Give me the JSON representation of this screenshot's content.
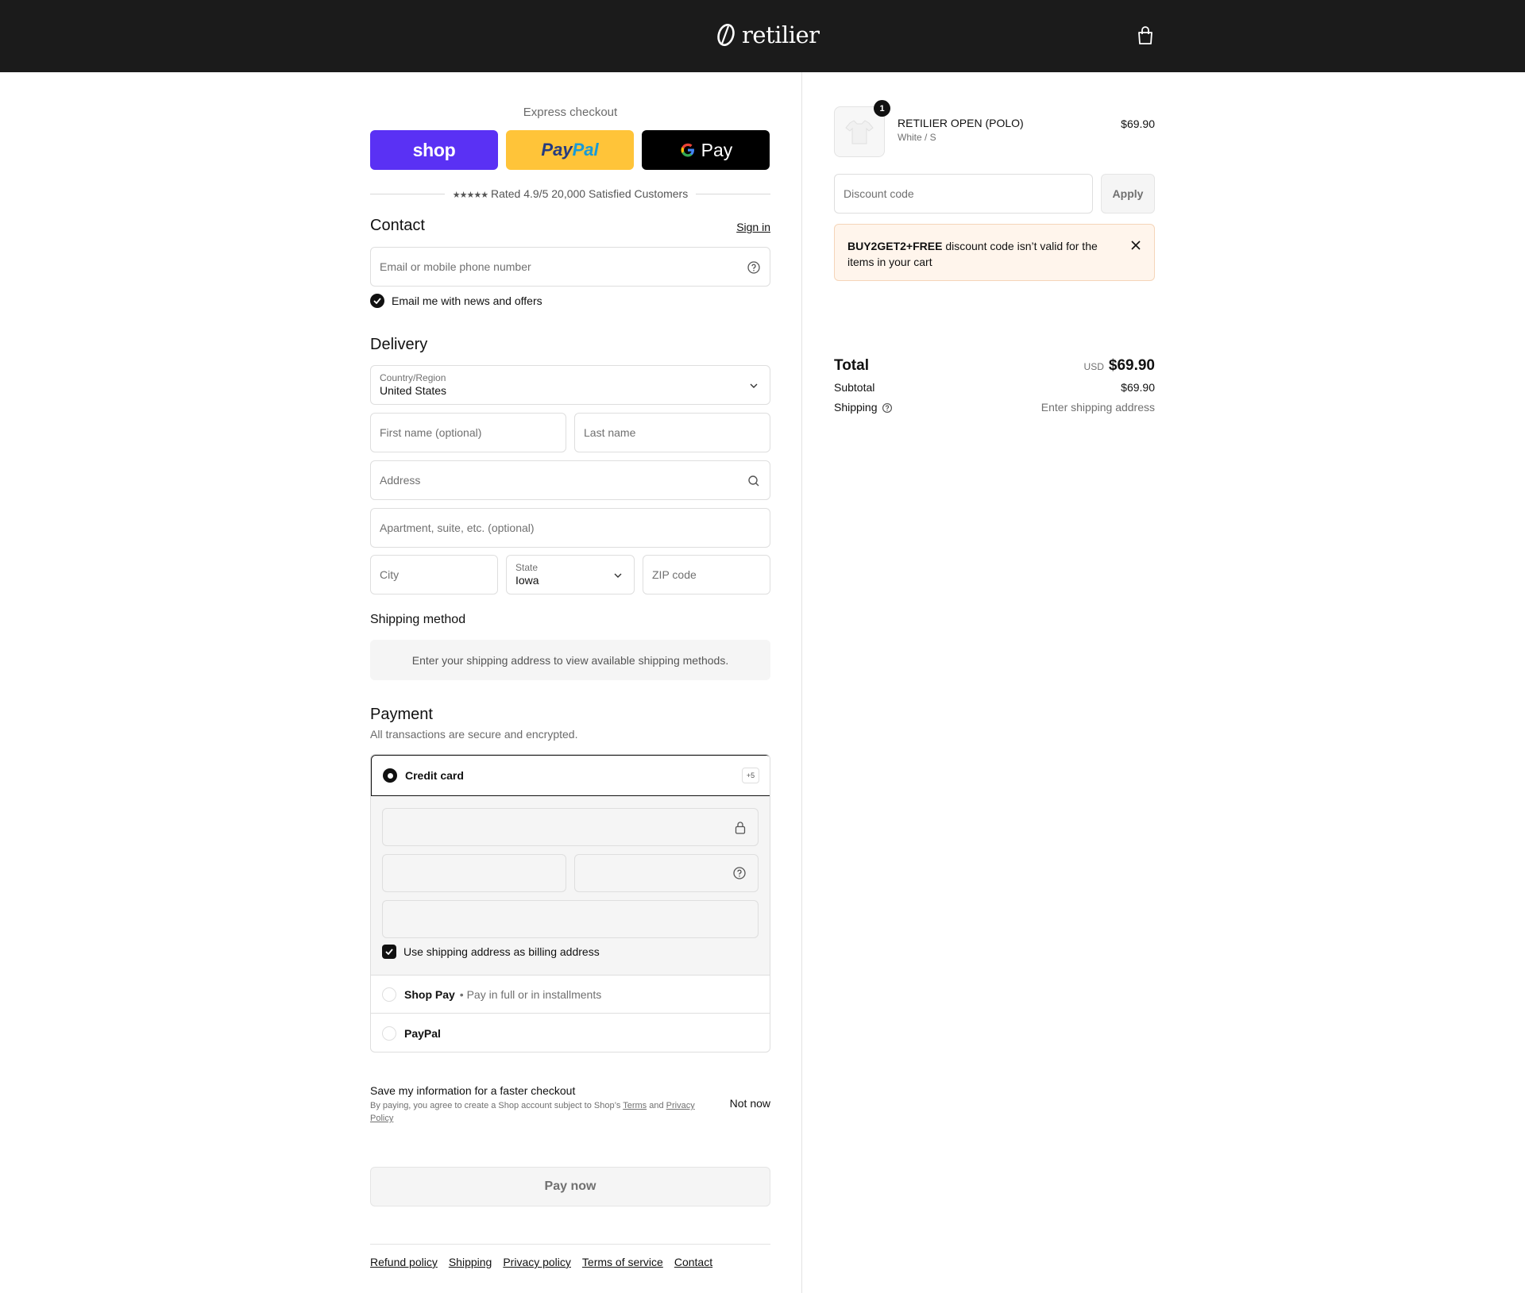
{
  "header": {
    "logo_text": "retilier",
    "cart_icon": "shopping-bag-icon"
  },
  "express": {
    "title": "Express checkout",
    "shop_label": "shop",
    "paypal_label_1": "Pay",
    "paypal_label_2": "Pal",
    "gpay_label": "Pay",
    "rating_stars": "★★★★★",
    "rating_text": "Rated 4.9/5 20,000 Satisfied Customers"
  },
  "contact": {
    "title": "Contact",
    "sign_in": "Sign in",
    "email_placeholder": "Email or mobile phone number",
    "news_label": "Email me with news and offers",
    "news_checked": true
  },
  "delivery": {
    "title": "Delivery",
    "country_label": "Country/Region",
    "country_value": "United States",
    "first_name_placeholder": "First name (optional)",
    "last_name_placeholder": "Last name",
    "address_placeholder": "Address",
    "apartment_placeholder": "Apartment, suite, etc. (optional)",
    "city_placeholder": "City",
    "state_label": "State",
    "state_value": "Iowa",
    "zip_placeholder": "ZIP code"
  },
  "shipping_method": {
    "title": "Shipping method",
    "info": "Enter your shipping address to view available shipping methods."
  },
  "payment": {
    "title": "Payment",
    "subtitle": "All transactions are secure and encrypted.",
    "credit_card_label": "Credit card",
    "more_badge": "+5",
    "billing_label": "Use shipping address as billing address",
    "billing_checked": true,
    "shop_pay_label": "Shop Pay",
    "shop_pay_sub": "• Pay in full or in installments",
    "paypal_label": "PayPal"
  },
  "save_info": {
    "title": "Save my information for a faster checkout",
    "legal_prefix": "By paying, you agree to create a Shop account subject to Shop’s",
    "terms": "Terms",
    "and": "and",
    "privacy": "Privacy Policy",
    "not_now": "Not now"
  },
  "pay_now": "Pay now",
  "footer": {
    "links": [
      "Refund policy",
      "Shipping",
      "Privacy policy",
      "Terms of service",
      "Contact"
    ]
  },
  "summary": {
    "product": {
      "quantity": "1",
      "name": "RETILIER OPEN (POLO)",
      "variant": "White / S",
      "price": "$69.90"
    },
    "discount_placeholder": "Discount code",
    "apply": "Apply",
    "alert_code": "BUY2GET2+FREE",
    "alert_text": "discount code isn’t valid for the items in your cart",
    "subtotal_label": "Subtotal",
    "subtotal_value": "$69.90",
    "shipping_label": "Shipping",
    "shipping_value": "Enter shipping address",
    "total_label": "Total",
    "total_currency": "USD",
    "total_value": "$69.90"
  }
}
